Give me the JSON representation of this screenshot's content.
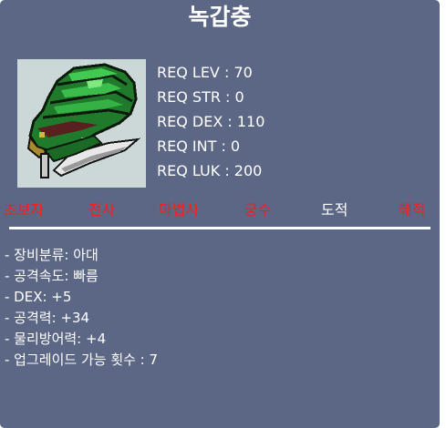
{
  "item": {
    "name": "녹갑충",
    "icon": "green-armored-gauntlet-icon"
  },
  "requirements": [
    "REQ LEV : 70",
    "REQ STR : 0",
    "REQ DEX : 110",
    "REQ INT : 0",
    "REQ LUK : 200"
  ],
  "jobs": [
    {
      "label": "초보자",
      "available": false
    },
    {
      "label": "전사",
      "available": false
    },
    {
      "label": "마법사",
      "available": false
    },
    {
      "label": "궁수",
      "available": false
    },
    {
      "label": "도적",
      "available": true
    },
    {
      "label": "해적",
      "available": false
    }
  ],
  "stats": [
    "- 장비분류: 아대",
    "- 공격속도: 빠름",
    "- DEX: +5",
    "- 공격력: +34",
    "- 물리방어력: +4",
    "- 업그레이드 가능 횟수 : 7"
  ],
  "colors": {
    "background": "#5b6785",
    "unavailable_job": "#ff1b1b",
    "available_job": "#ffffff",
    "icon_frame": "#ccd8d8",
    "item_green": "#2a9a3a"
  }
}
